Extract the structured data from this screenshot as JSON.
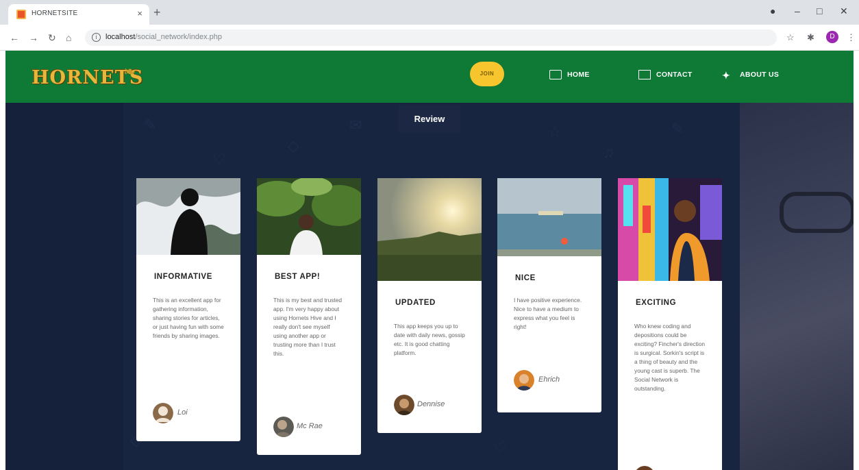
{
  "browser": {
    "tab_title": "HORNETSITE",
    "tab_close": "×",
    "new_tab": "+",
    "url_host": "localhost",
    "url_path": "/social_network/index.php"
  },
  "navbar": {
    "logo_text": "HORNETS",
    "join_label": "JOIN",
    "home_label": "HOME",
    "contact_label": "CONTACT",
    "about_label": "ABOUT US",
    "colors": {
      "bar": "#0f7a35",
      "join": "#f7c52d"
    }
  },
  "section": {
    "title": "Review"
  },
  "cards": [
    {
      "title": "INFORMATIVE",
      "text": "This is an excellent app for gathering information, sharing stories for articles, or just having fun with some friends by sharing images.",
      "author": "Loi"
    },
    {
      "title": "BEST APP!",
      "text": "This is my best and trusted app. I'm very happy about using Hornets Hive and I really don't see myself using another app or trusting more than I trust this.",
      "author": "Mc Rae"
    },
    {
      "title": "UPDATED",
      "text": "This app keeps you up to date with daily news, gossip etc. It is good chatting platform.",
      "author": "Dennise"
    },
    {
      "title": "NICE",
      "text": "I have positive experience. Nice to have a medium to express what you feel is right!",
      "author": "Ehrich"
    },
    {
      "title": "EXCITING",
      "text": "Who knew coding and depositions could be exciting? Fincher's direction is surgical. Sorkin's script is a thing of beauty and the young cast is superb. The Social Network is outstanding.",
      "author": ""
    }
  ]
}
